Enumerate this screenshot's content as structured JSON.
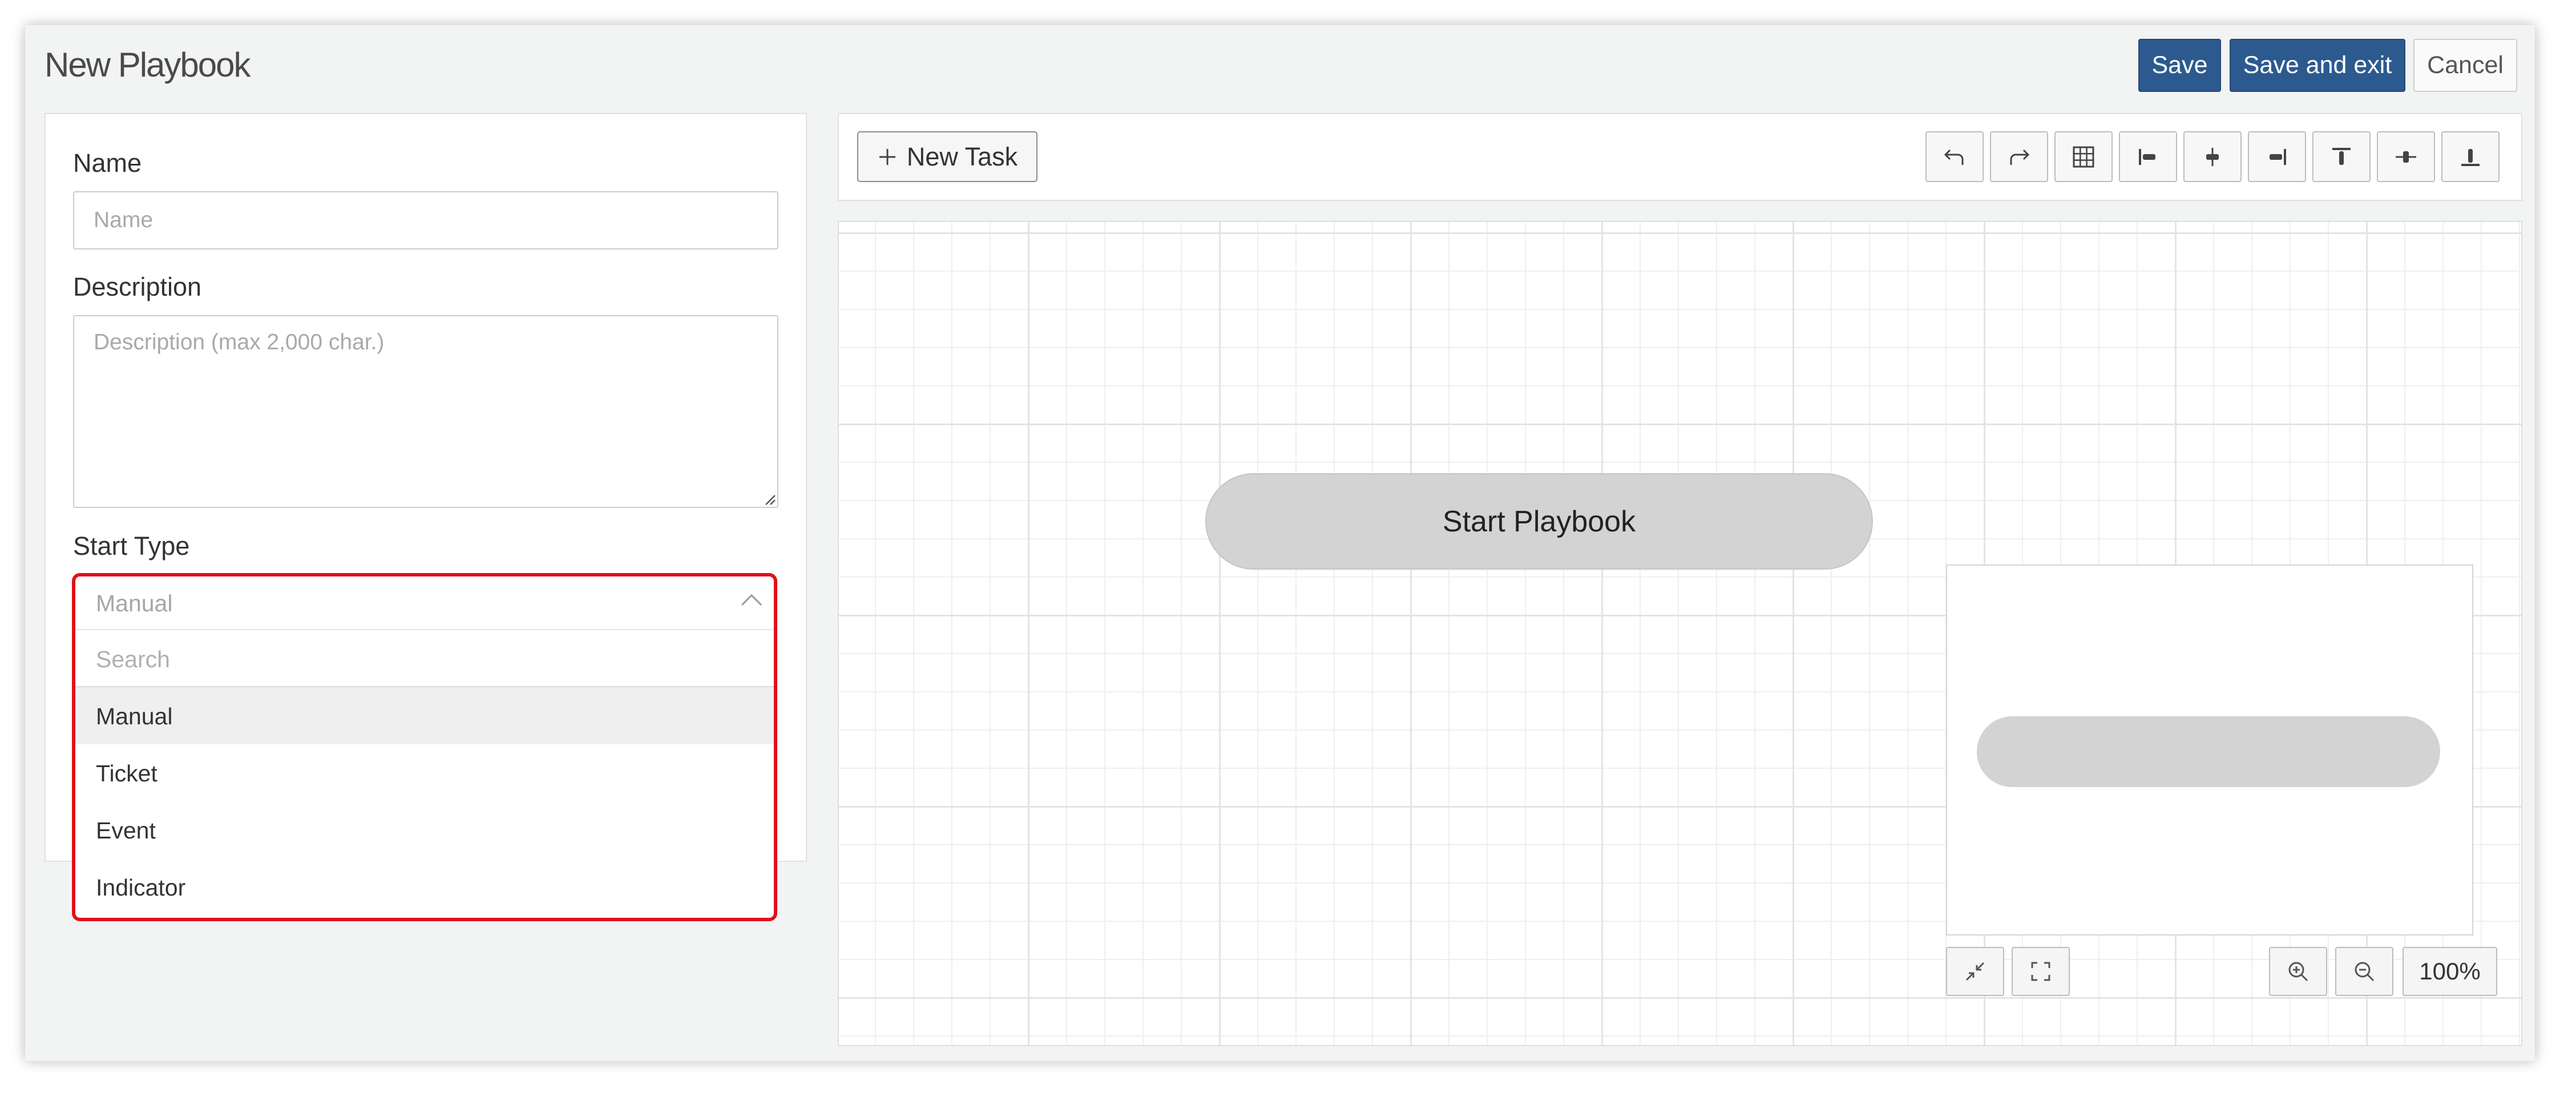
{
  "header": {
    "title": "New Playbook",
    "save_label": "Save",
    "save_exit_label": "Save and exit",
    "cancel_label": "Cancel"
  },
  "form": {
    "name_label": "Name",
    "name_placeholder": "Name",
    "name_value": "",
    "description_label": "Description",
    "description_placeholder": "Description (max 2,000 char.)",
    "description_value": "",
    "start_type_label": "Start Type",
    "start_type": {
      "selected": "Manual",
      "search_placeholder": "Search",
      "options": [
        "Manual",
        "Ticket",
        "Event",
        "Indicator"
      ],
      "active_option": "Manual"
    }
  },
  "toolbar": {
    "new_task_label": "New Task",
    "tools": [
      "undo-icon",
      "redo-icon",
      "grid-icon",
      "align-left-icon",
      "align-center-icon",
      "align-right-icon",
      "align-top-icon",
      "align-middle-icon",
      "align-bottom-icon"
    ]
  },
  "canvas": {
    "start_node_label": "Start Playbook",
    "zoom_level": "100%"
  },
  "colors": {
    "primary": "#2c5a8e",
    "dropdown_highlight": "#e0101a",
    "node_fill": "#d3d3d3"
  }
}
